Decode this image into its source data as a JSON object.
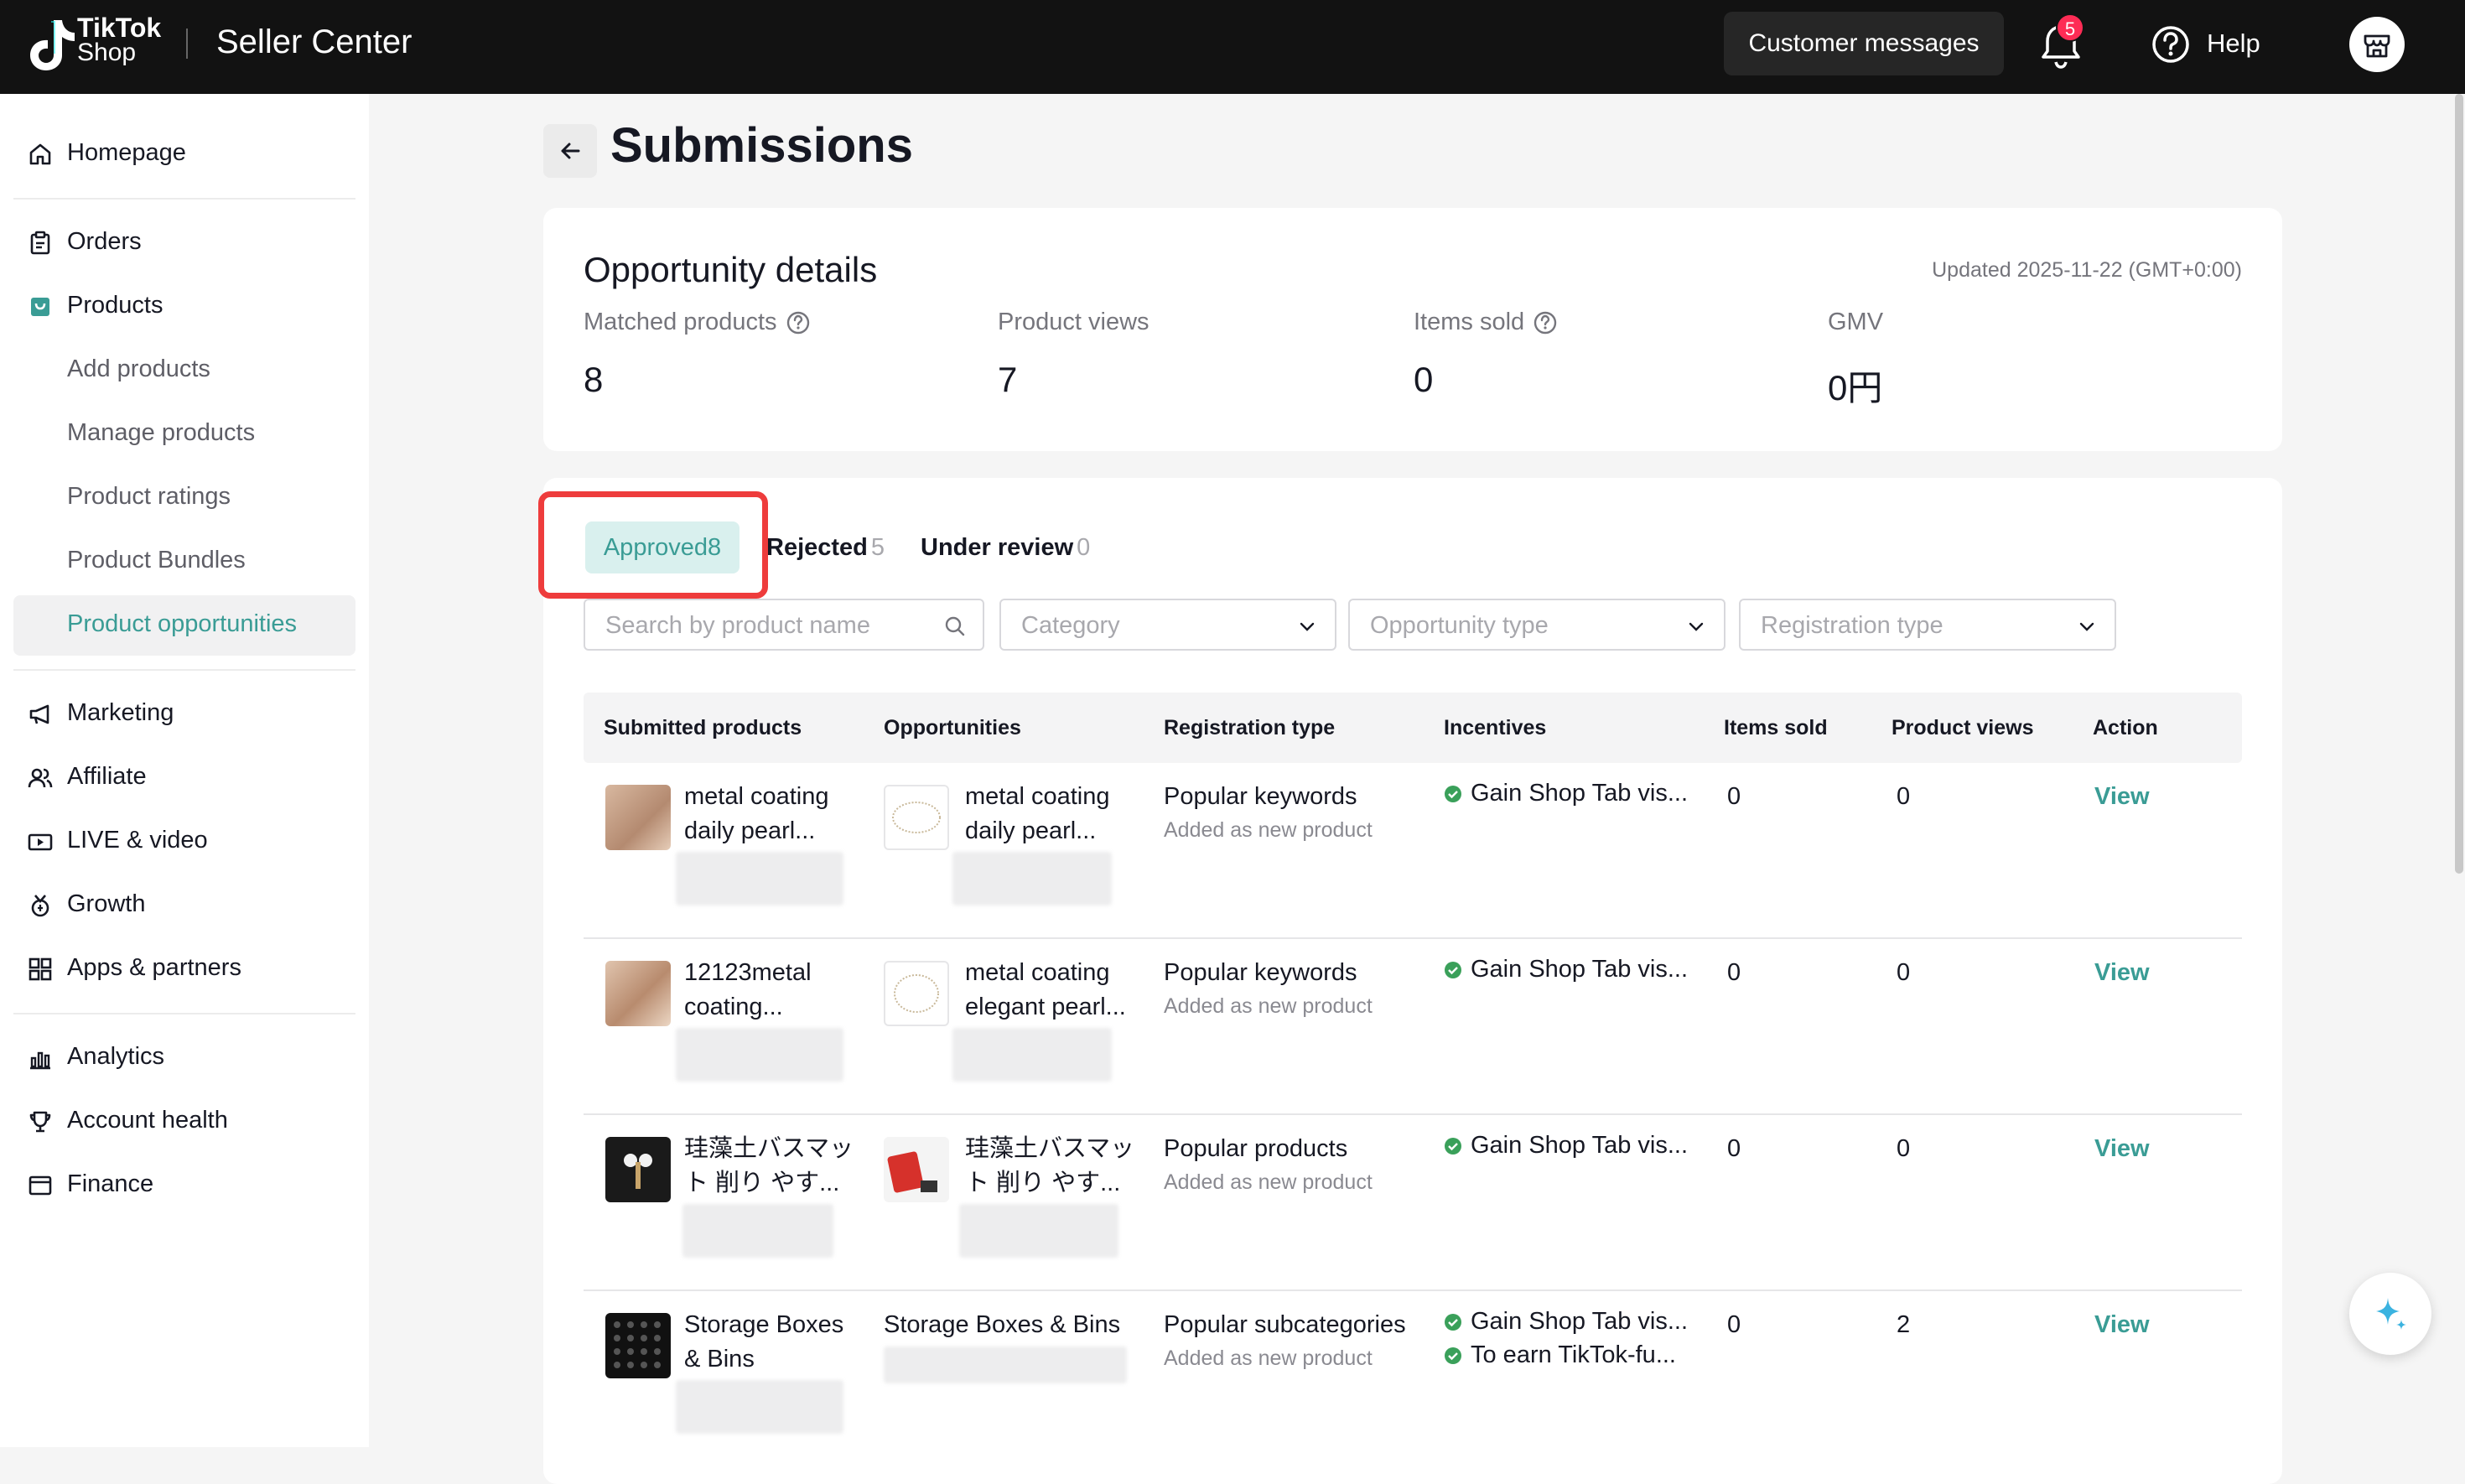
{
  "header": {
    "logo_line1": "TikTok",
    "logo_line2": "Shop",
    "app_title": "Seller Center",
    "customer_messages": "Customer messages",
    "notification_count": "5",
    "help": "Help"
  },
  "sidebar": {
    "homepage": "Homepage",
    "orders": "Orders",
    "products": "Products",
    "add_products": "Add products",
    "manage_products": "Manage products",
    "product_ratings": "Product ratings",
    "product_bundles": "Product Bundles",
    "product_opportunities": "Product opportunities",
    "marketing": "Marketing",
    "affiliate": "Affiliate",
    "live_video": "LIVE & video",
    "growth": "Growth",
    "apps_partners": "Apps & partners",
    "analytics": "Analytics",
    "account_health": "Account health",
    "finance": "Finance"
  },
  "page": {
    "title": "Submissions"
  },
  "details": {
    "title": "Opportunity details",
    "updated": "Updated 2025-11-22  (GMT+0:00)",
    "stats": [
      {
        "label": "Matched products",
        "value": "8"
      },
      {
        "label": "Product views",
        "value": "7"
      },
      {
        "label": "Items sold",
        "value": "0"
      },
      {
        "label": "GMV",
        "value": "0円"
      }
    ]
  },
  "tabs": {
    "approved": {
      "label": "Approved",
      "count": "8"
    },
    "rejected": {
      "label": "Rejected",
      "count": "5"
    },
    "under_review": {
      "label": "Under review",
      "count": "0"
    }
  },
  "filters": {
    "search_placeholder": "Search by product name",
    "category": "Category",
    "opportunity_type": "Opportunity type",
    "registration_type": "Registration type"
  },
  "table": {
    "headers": {
      "submitted": "Submitted products",
      "opportunities": "Opportunities",
      "registration": "Registration type",
      "incentives": "Incentives",
      "items_sold": "Items sold",
      "product_views": "Product views",
      "action": "Action"
    },
    "rows": [
      {
        "sub_l1": "metal coating",
        "sub_l2": "daily pearl...",
        "opp_l1": "metal coating",
        "opp_l2": "daily pearl...",
        "reg": "Popular keywords",
        "reg_sub": "Added as new product",
        "inc1": "Gain Shop Tab vis...",
        "inc2": "",
        "sold": "0",
        "views": "0",
        "action": "View"
      },
      {
        "sub_l1": "12123metal",
        "sub_l2": "coating...",
        "opp_l1": "metal coating",
        "opp_l2": "elegant pearl...",
        "reg": "Popular keywords",
        "reg_sub": "Added as new product",
        "inc1": "Gain Shop Tab vis...",
        "inc2": "",
        "sold": "0",
        "views": "0",
        "action": "View"
      },
      {
        "sub_l1": "珪藻土バスマッ",
        "sub_l2": "ト 削り やす...",
        "opp_l1": "珪藻土バスマッ",
        "opp_l2": "ト 削り やす...",
        "reg": "Popular products",
        "reg_sub": "Added as new product",
        "inc1": "Gain Shop Tab vis...",
        "inc2": "",
        "sold": "0",
        "views": "0",
        "action": "View"
      },
      {
        "sub_l1": "Storage Boxes",
        "sub_l2": "& Bins",
        "opp_l1": "Storage Boxes & Bins",
        "opp_l2": "",
        "reg": "Popular subcategories",
        "reg_sub": "Added as new product",
        "inc1": "Gain Shop Tab vis...",
        "inc2": "To earn TikTok-fu...",
        "sold": "0",
        "views": "2",
        "action": "View"
      }
    ]
  },
  "colors": {
    "accent": "#3a9c95",
    "highlight": "#ee3c3c",
    "topbar": "#121212",
    "badge": "#fe2c55"
  }
}
